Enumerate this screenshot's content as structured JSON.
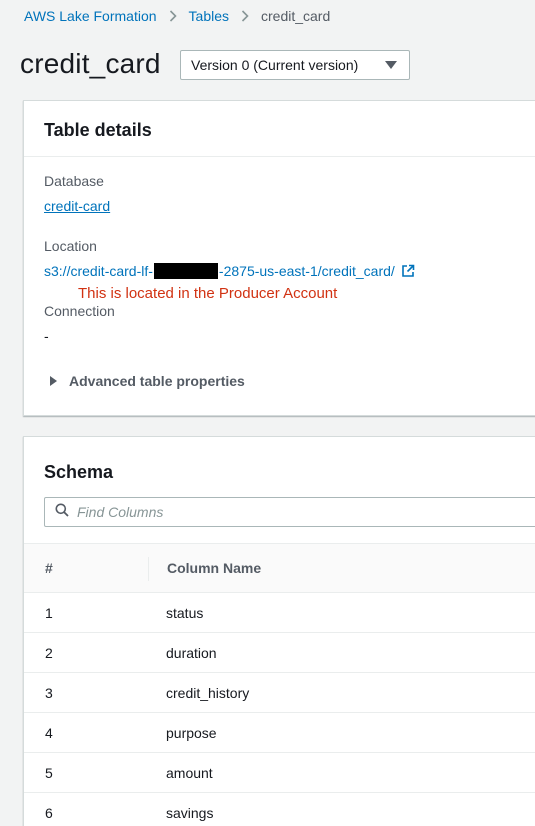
{
  "breadcrumb": {
    "items": [
      "AWS Lake Formation",
      "Tables"
    ],
    "current": "credit_card"
  },
  "page": {
    "title": "credit_card",
    "version_select": "Version 0 (Current version)"
  },
  "details": {
    "header": "Table details",
    "database_label": "Database",
    "database_value": "credit-card",
    "location_label": "Location",
    "location_prefix": "s3://credit-card-lf-",
    "location_suffix": "-2875-us-east-1/credit_card/",
    "annotation": "This is located in the Producer Account",
    "connection_label": "Connection",
    "connection_value": "-",
    "advanced_label": "Advanced table properties"
  },
  "schema": {
    "header": "Schema",
    "search_placeholder": "Find Columns",
    "columns": [
      "#",
      "Column Name"
    ],
    "rows": [
      {
        "num": "1",
        "name": "status"
      },
      {
        "num": "2",
        "name": "duration"
      },
      {
        "num": "3",
        "name": "credit_history"
      },
      {
        "num": "4",
        "name": "purpose"
      },
      {
        "num": "5",
        "name": "amount"
      },
      {
        "num": "6",
        "name": "savings"
      }
    ]
  },
  "icons": {
    "breadcrumb_separator": "chevron-right-icon",
    "external_link": "external-link-icon",
    "search": "search-icon",
    "dropdown": "caret-down-icon",
    "expand": "caret-right-icon"
  },
  "colors": {
    "link": "#0073bb",
    "annotation": "#d13212",
    "background": "#f2f3f3"
  }
}
